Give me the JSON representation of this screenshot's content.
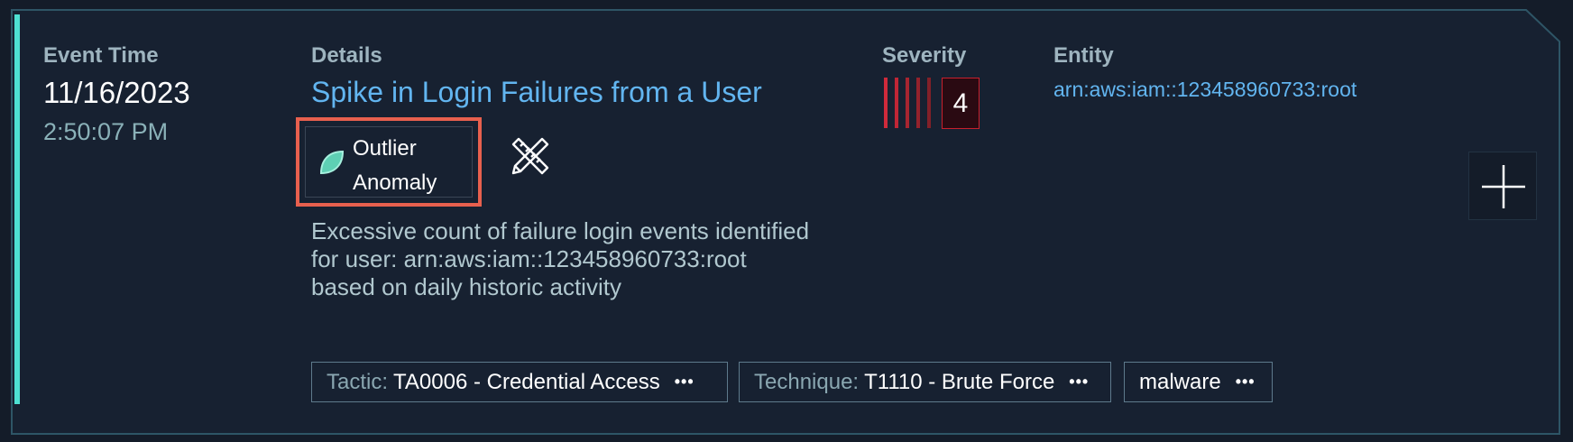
{
  "event": {
    "time_label": "Event Time",
    "date": "11/16/2023",
    "time": "2:50:07 PM"
  },
  "details": {
    "label": "Details",
    "title": "Spike in Login Failures from a User",
    "badge_line1": "Outlier",
    "badge_line2": "Anomaly",
    "description": "Excessive count of failure login events identified for user: arn:aws:iam::123458960733:root based on daily historic activity"
  },
  "severity": {
    "label": "Severity",
    "value": "4",
    "level_of_5": 4
  },
  "entity": {
    "label": "Entity",
    "value": "arn:aws:iam::123458960733:root"
  },
  "tags": [
    {
      "key": "Tactic",
      "value": "TA0006 - Credential Access",
      "more": "•••"
    },
    {
      "key": "Technique",
      "value": "T1110 - Brute Force",
      "more": "•••"
    },
    {
      "key": "",
      "value": "malware",
      "more": "•••"
    }
  ],
  "colors": {
    "accent": "#4ee0d2",
    "link": "#62b5f0",
    "highlight_box": "#e8604e",
    "severity": "#c8202d"
  },
  "icons": {
    "badge": "leaf-icon",
    "tool": "pencil-ruler-icon",
    "add": "plus-icon"
  }
}
